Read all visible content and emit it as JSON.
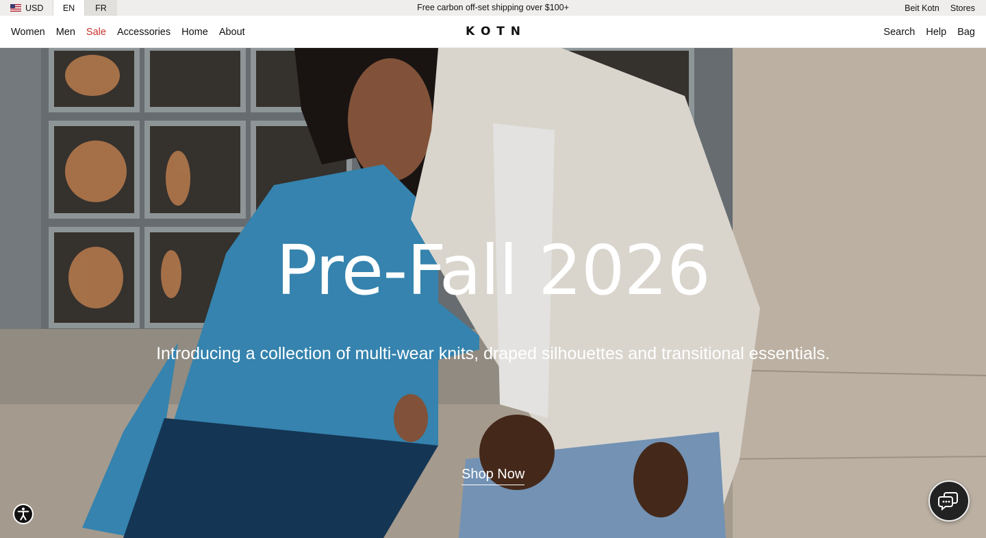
{
  "utility": {
    "currency": "USD",
    "languages": [
      "EN",
      "FR"
    ],
    "announcement": "Free carbon off-set shipping over $100+",
    "links": [
      "Beit Kotn",
      "Stores"
    ]
  },
  "nav": {
    "items": [
      "Women",
      "Men",
      "Sale",
      "Accessories",
      "Home",
      "About"
    ],
    "logo_letters": [
      "K",
      "O",
      "T",
      "N"
    ],
    "right": [
      "Search",
      "Help",
      "Bag"
    ]
  },
  "hero": {
    "title": "Pre-Fall 2026",
    "subtitle": "Introducing a collection of multi-wear knits, draped silhouettes and transitional essentials.",
    "cta": "Shop Now"
  },
  "colors": {
    "sale": "#c9302c",
    "utility_bar": "#efeeec",
    "hero_text": "#ffffff"
  },
  "icons": {
    "currency_flag": "us-flag-icon",
    "accessibility": "accessibility-icon",
    "chat": "chat-icon"
  }
}
